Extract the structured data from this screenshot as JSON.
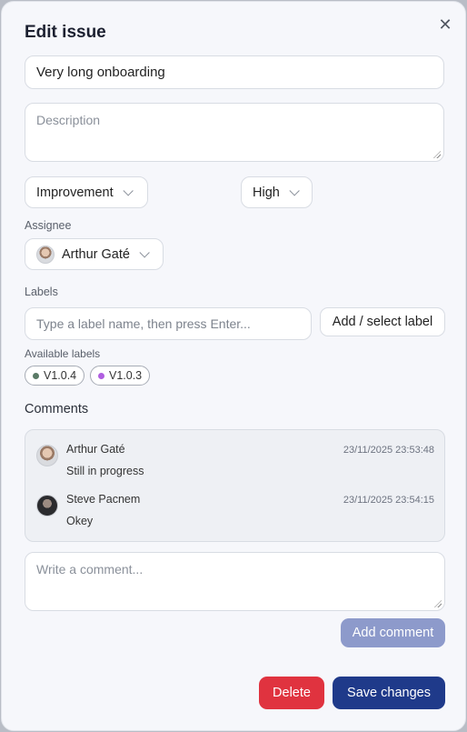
{
  "dialog": {
    "title": "Edit issue",
    "close_icon": "close-icon"
  },
  "form": {
    "title_value": "Very long onboarding",
    "description_placeholder": "Description",
    "type_value": "Improvement",
    "priority_value": "High",
    "assignee_label": "Assignee",
    "assignee_value": "Arthur Gaté",
    "labels_label": "Labels",
    "label_input_placeholder": "Type a label name, then press Enter...",
    "add_label_button": "Add / select label",
    "available_labels_label": "Available labels",
    "available_labels": [
      {
        "name": "V1.0.4",
        "color": "#5a7a66"
      },
      {
        "name": "V1.0.3",
        "color": "#b05ee0"
      }
    ]
  },
  "comments": {
    "title": "Comments",
    "items": [
      {
        "author": "Arthur Gaté",
        "time": "23/11/2025 23:53:48",
        "text": "Still in progress"
      },
      {
        "author": "Steve Pacnem",
        "time": "23/11/2025 23:54:15",
        "text": "Okey"
      }
    ],
    "input_placeholder": "Write a comment...",
    "add_button": "Add comment"
  },
  "actions": {
    "delete": "Delete",
    "save": "Save changes"
  },
  "colors": {
    "primary": "#1f3a8a",
    "danger": "#e0333f",
    "add_comment_disabled": "#8d9acb"
  }
}
